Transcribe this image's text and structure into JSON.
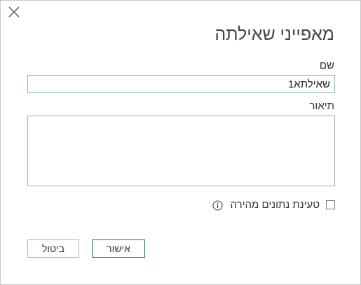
{
  "dialog": {
    "title": "מאפייני שאילתה",
    "name_label": "שם",
    "name_value": "שאילתא1",
    "description_label": "תיאור",
    "description_value": "",
    "fast_load_label": "טעינת נתונים מהירה",
    "fast_load_checked": false,
    "ok_label": "אישור",
    "cancel_label": "ביטול",
    "icons": {
      "close": "close-icon",
      "info": "info-icon"
    },
    "colors": {
      "accent": "#217346",
      "input_focus_border": "#8cbf9a"
    }
  }
}
